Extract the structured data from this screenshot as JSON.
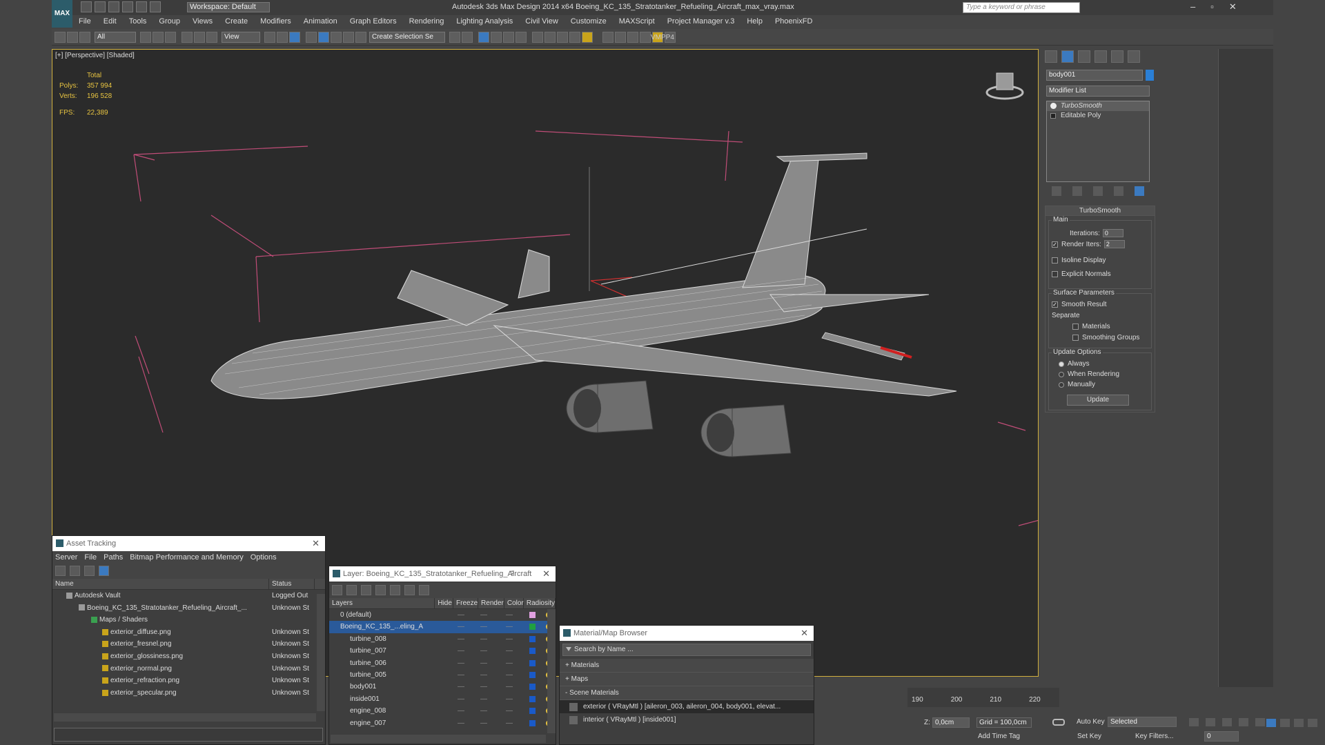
{
  "app": {
    "title": "Autodesk 3ds Max Design 2014 x64     Boeing_KC_135_Stratotanker_Refueling_Aircraft_max_vray.max",
    "logo": "MAX",
    "workspace": "Workspace: Default",
    "search_placeholder": "Type a keyword or phrase"
  },
  "menu": [
    "File",
    "Edit",
    "Tools",
    "Group",
    "Views",
    "Create",
    "Modifiers",
    "Animation",
    "Graph Editors",
    "Rendering",
    "Lighting Analysis",
    "Civil View",
    "Customize",
    "MAXScript",
    "Project Manager v.3",
    "Help",
    "PhoenixFD"
  ],
  "toolbar": {
    "filter": "All",
    "ref_coord": "View",
    "selection_set": "Create Selection Se",
    "vmpp": "VMPP4"
  },
  "viewport": {
    "label": "[+] [Perspective] [Shaded]",
    "stats": {
      "header": "Total",
      "polys_label": "Polys:",
      "polys": "357 994",
      "verts_label": "Verts:",
      "verts": "196 528",
      "fps_label": "FPS:",
      "fps": "22,389"
    }
  },
  "command_panel": {
    "object_name": "body001",
    "modifier_list": "Modifier List",
    "stack": [
      "TurboSmooth",
      "Editable Poly"
    ],
    "rollout_title": "TurboSmooth",
    "main_label": "Main",
    "iterations_label": "Iterations:",
    "iterations": "0",
    "render_iters_label": "Render Iters:",
    "render_iters": "2",
    "isoline": "Isoline Display",
    "explicit_normals": "Explicit Normals",
    "surface_params": "Surface Parameters",
    "smooth_result": "Smooth Result",
    "separate": "Separate",
    "materials": "Materials",
    "smoothing_groups": "Smoothing Groups",
    "update_options": "Update Options",
    "always": "Always",
    "when_rendering": "When Rendering",
    "manually": "Manually",
    "update_btn": "Update"
  },
  "asset_tracking": {
    "title": "Asset Tracking",
    "menu": [
      "Server",
      "File",
      "Paths",
      "Bitmap Performance and Memory",
      "Options"
    ],
    "col_name": "Name",
    "col_status": "Status",
    "rows": [
      {
        "name": "Autodesk Vault",
        "status": "Logged Out"
      },
      {
        "name": "Boeing_KC_135_Stratotanker_Refueling_Aircraft_...",
        "status": "Unknown St"
      },
      {
        "name": "Maps / Shaders",
        "status": ""
      },
      {
        "name": "exterior_diffuse.png",
        "status": "Unknown St"
      },
      {
        "name": "exterior_fresnel.png",
        "status": "Unknown St"
      },
      {
        "name": "exterior_glossiness.png",
        "status": "Unknown St"
      },
      {
        "name": "exterior_normal.png",
        "status": "Unknown St"
      },
      {
        "name": "exterior_refraction.png",
        "status": "Unknown St"
      },
      {
        "name": "exterior_specular.png",
        "status": "Unknown St"
      }
    ]
  },
  "layers": {
    "title": "Layer: Boeing_KC_135_Stratotanker_Refueling_Aircraft",
    "help": "?",
    "cols": [
      "Layers",
      "Hide",
      "Freeze",
      "Render",
      "Color",
      "Radiosity"
    ],
    "rows": [
      {
        "name": "0 (default)",
        "color": "#e0a0e0"
      },
      {
        "name": "Boeing_KC_135_...eling_A",
        "color": "#20a040"
      },
      {
        "name": "turbine_008",
        "color": "#1a5ac8"
      },
      {
        "name": "turbine_007",
        "color": "#1a5ac8"
      },
      {
        "name": "turbine_006",
        "color": "#1a5ac8"
      },
      {
        "name": "turbine_005",
        "color": "#1a5ac8"
      },
      {
        "name": "body001",
        "color": "#1a5ac8"
      },
      {
        "name": "inside001",
        "color": "#1a5ac8"
      },
      {
        "name": "engine_008",
        "color": "#1a5ac8"
      },
      {
        "name": "engine_007",
        "color": "#1a5ac8"
      }
    ]
  },
  "material_browser": {
    "title": "Material/Map Browser",
    "search": "Search by Name ...",
    "sections": [
      "+ Materials",
      "+ Maps",
      "- Scene Materials"
    ],
    "items": [
      "exterior  ( VRayMtl ) [aileron_003, aileron_004, body001, elevat...",
      "interior  ( VRayMtl ) [inside001]"
    ]
  },
  "timeline": {
    "ticks": [
      "190",
      "200",
      "210",
      "220"
    ]
  },
  "statusbar": {
    "z_label": "Z:",
    "z_value": "0,0cm",
    "grid": "Grid = 100,0cm",
    "add_time_tag": "Add Time Tag",
    "auto_key": "Auto Key",
    "auto_key_mode": "Selected",
    "set_key": "Set Key",
    "key_filters": "Key Filters...",
    "frame": "0"
  }
}
